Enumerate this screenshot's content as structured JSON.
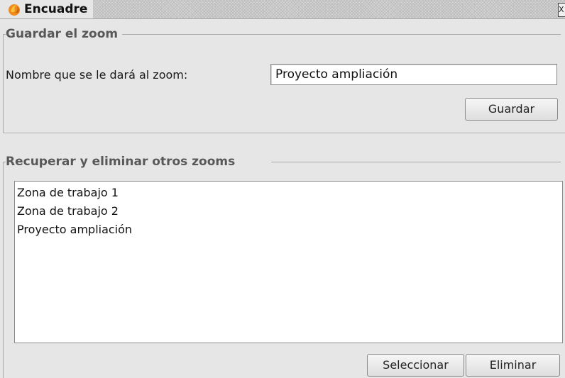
{
  "window": {
    "title": "Encuadre",
    "icon": "app-flame-icon",
    "close_glyph": "X"
  },
  "save_section": {
    "title": "Guardar el zoom",
    "name_label": "Nombre que se le dará al zoom:",
    "name_value": "Proyecto ampliación",
    "save_button": "Guardar"
  },
  "manage_section": {
    "title": "Recuperar y eliminar otros zooms",
    "items": [
      "Zona de trabajo 1",
      "Zona de trabajo 2",
      "Proyecto ampliación"
    ],
    "select_button": "Seleccionar",
    "delete_button": "Eliminar"
  }
}
